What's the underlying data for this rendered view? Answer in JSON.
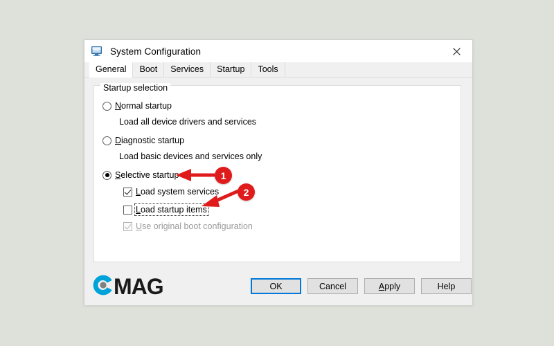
{
  "window": {
    "title": "System Configuration",
    "icon": "monitor-icon",
    "close_label": "×"
  },
  "tabs": [
    {
      "label": "General",
      "selected": true
    },
    {
      "label": "Boot",
      "selected": false
    },
    {
      "label": "Services",
      "selected": false
    },
    {
      "label": "Startup",
      "selected": false
    },
    {
      "label": "Tools",
      "selected": false
    }
  ],
  "groupbox": {
    "legend": "Startup selection"
  },
  "options": {
    "normal": {
      "label_pre": "",
      "label_acc": "N",
      "label_post": "ormal startup",
      "checked": false,
      "description": "Load all device drivers and services"
    },
    "diagnostic": {
      "label_pre": "",
      "label_acc": "D",
      "label_post": "iagnostic startup",
      "checked": false,
      "description": "Load basic devices and services only"
    },
    "selective": {
      "label_pre": "",
      "label_acc": "S",
      "label_post": "elective startup",
      "checked": true
    }
  },
  "checkboxes": {
    "load_system_services": {
      "label_acc": "L",
      "label_post": "oad system services",
      "checked": true,
      "disabled": false,
      "focused": false
    },
    "load_startup_items": {
      "label_acc": "L",
      "label_post": "oad startup items",
      "checked": false,
      "disabled": false,
      "focused": true
    },
    "use_original_boot_configuration": {
      "label_acc": "U",
      "label_post": "se original boot configuration",
      "checked": true,
      "disabled": true,
      "focused": false
    }
  },
  "logo": {
    "text": "MAG",
    "mark": "c-circle-logo",
    "accent_color": "#00a3d9",
    "dot_color": "#808080"
  },
  "buttons": {
    "ok": {
      "label": "OK",
      "default": true
    },
    "cancel": {
      "label": "Cancel",
      "default": false
    },
    "apply": {
      "label_acc": "A",
      "label_post": "pply",
      "default": false
    },
    "help": {
      "label": "Help",
      "default": false
    }
  },
  "annotations": {
    "marker_color": "#e01b1b",
    "items": [
      {
        "number": "1",
        "target": "selective-startup-radio"
      },
      {
        "number": "2",
        "target": "load-startup-items-checkbox"
      }
    ]
  }
}
